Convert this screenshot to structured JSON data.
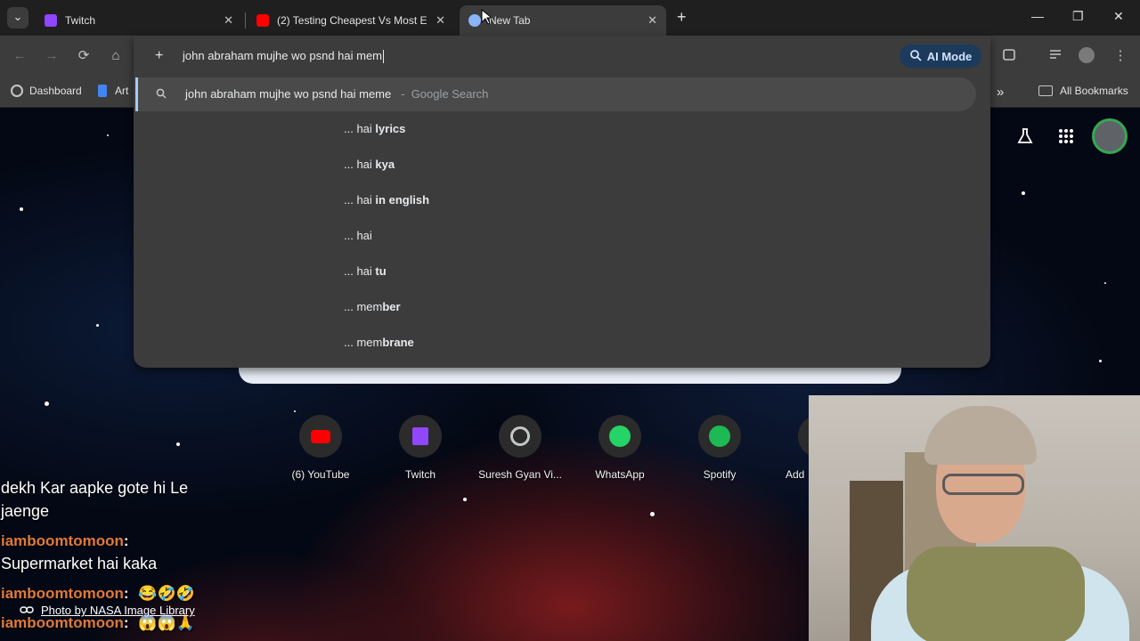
{
  "tabs": [
    {
      "title": "Twitch",
      "favicon_color": "#9146ff",
      "active": false
    },
    {
      "title": "(2) Testing Cheapest Vs Most Ex",
      "favicon_color": "#ff0000",
      "active": false
    },
    {
      "title": "New Tab",
      "favicon_color": "#8ab4f8",
      "active": true
    }
  ],
  "window": {
    "minimize": "—",
    "restore": "❐",
    "close": "✕",
    "tab_close": "✕",
    "new_tab": "+",
    "tab_menu": "⌄"
  },
  "toolbar": {
    "back": "←",
    "forward": "→",
    "reload": "⟳",
    "home": "⌂",
    "ai_mode_label": "AI Mode",
    "menu": "⋮"
  },
  "omnibox": {
    "input_value": "john abraham mujhe wo psnd hai mem",
    "first_suggestion": {
      "query": "john abraham mujhe wo psnd hai meme",
      "separator": "-",
      "source": "Google Search"
    },
    "suggestions": [
      {
        "prefix": "... hai",
        "bold": "lyrics"
      },
      {
        "prefix": "... hai",
        "bold": "kya"
      },
      {
        "prefix": "... hai",
        "bold": "in english"
      },
      {
        "prefix": "... hai",
        "bold": ""
      },
      {
        "prefix": "... hai",
        "bold": "tu"
      },
      {
        "prefix": "... mem",
        "bold": "ber"
      },
      {
        "prefix": "... mem",
        "bold": "brane"
      }
    ]
  },
  "bookmarks": {
    "dashboard": "Dashboard",
    "art": "Art",
    "more": "»",
    "all_bookmarks": "All Bookmarks"
  },
  "shortcuts": [
    {
      "label": "(6) YouTube",
      "color": "#ff0000"
    },
    {
      "label": "Twitch",
      "color": "#9146ff"
    },
    {
      "label": "Suresh Gyan Vi...",
      "color": "#5f6368"
    },
    {
      "label": "WhatsApp",
      "color": "#25d366"
    },
    {
      "label": "Spotify",
      "color": "#1db954"
    },
    {
      "label": "Add",
      "color": "#3c3c3c"
    }
  ],
  "chat": {
    "line1": "dekh Kar aapke gote hi Le",
    "line2": "jaenge",
    "user1": "iamboomtomoon",
    "msg1": "Supermarket hai kaka",
    "user2": "iamboomtomoon",
    "emoji2": "😂🤣🤣",
    "user3": "iamboomtomoon",
    "emoji3": "😱😱🙏"
  },
  "photo_credit": "Photo by NASA Image Library"
}
